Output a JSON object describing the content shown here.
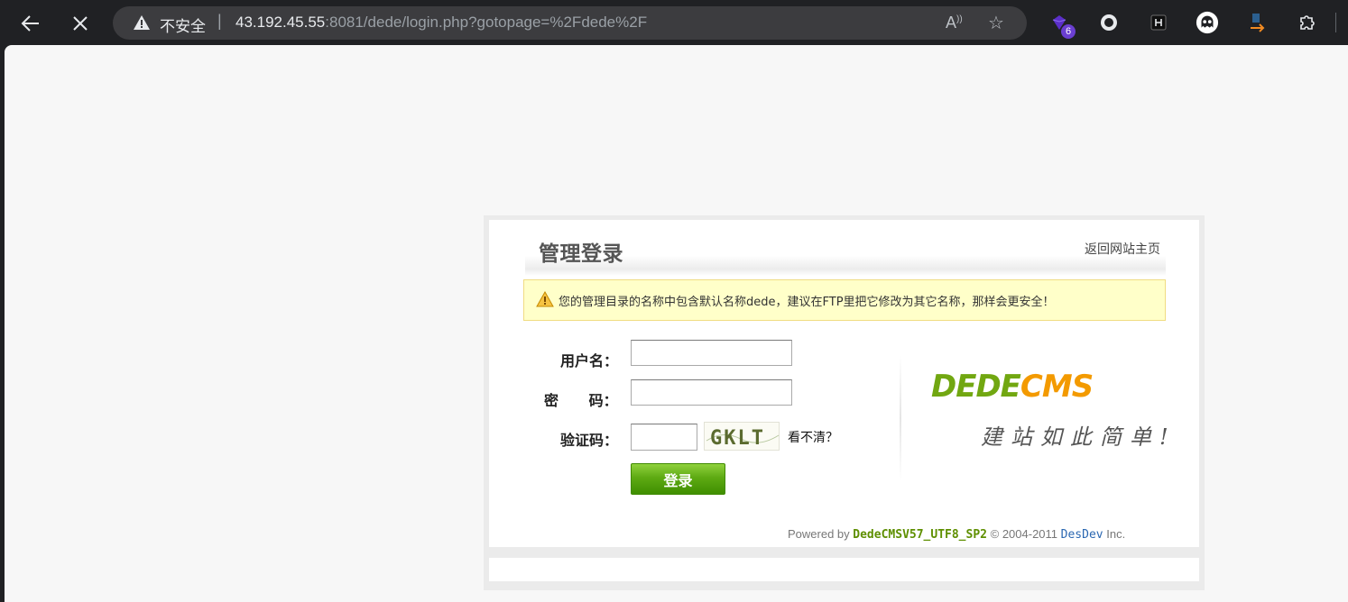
{
  "browser": {
    "security_label": "不安全",
    "separator": "|",
    "url_host": "43.192.45.55",
    "url_rest": ":8081/dede/login.php?gotopage=%2Fdede%2F",
    "extensions": [
      {
        "name": "gem-extension-icon",
        "color": "#5b2fc9"
      },
      {
        "name": "circle-extension-icon",
        "color": "#e8eaed"
      },
      {
        "name": "h-extension-icon",
        "color": "#e8eaed"
      },
      {
        "name": "ghost-extension-icon",
        "color": "#ffffff"
      },
      {
        "name": "arrow-extension-icon",
        "color": "#f28b22"
      },
      {
        "name": "puzzle-extensions-icon",
        "color": "#e8eaed"
      }
    ],
    "extension_badge": "6"
  },
  "login": {
    "title": "管理登录",
    "back_home": "返回网站主页",
    "notice": "您的管理目录的名称中包含默认名称dede，建议在FTP里把它修改为其它名称，那样会更安全！",
    "username_label": "用户名：",
    "password_label": "密 码：",
    "captcha_label": "验证码：",
    "captcha_text": "GKLT",
    "refresh_link": "看不清？",
    "submit_label": "登录",
    "logo_dede": "DEDE",
    "logo_cms": "CMS",
    "slogan": "建站如此简单!"
  },
  "footer": {
    "powered_by": "Powered by",
    "version": "DedeCMSV57_UTF8_SP2",
    "copyright": "© 2004-2011",
    "developer": "DesDev",
    "inc": "Inc."
  },
  "colors": {
    "brand_green": "#71a711",
    "brand_orange": "#f39a00",
    "notice_bg": "#ffffc9",
    "button_green": "#5eaa13"
  }
}
